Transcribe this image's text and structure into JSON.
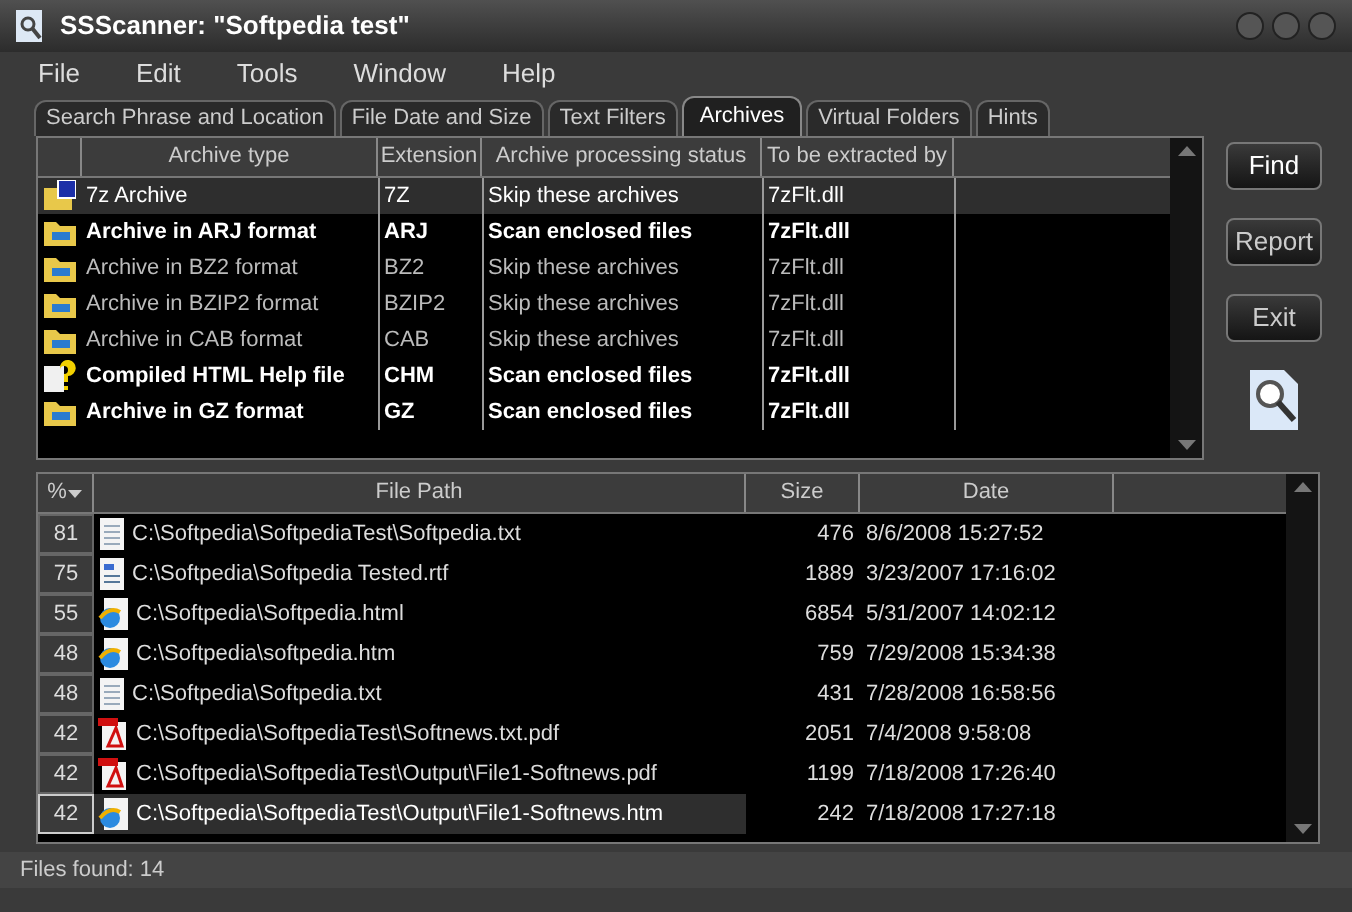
{
  "window": {
    "title": "SSScanner: \"Softpedia test\""
  },
  "menu": [
    "File",
    "Edit",
    "Tools",
    "Window",
    "Help"
  ],
  "tabs": [
    {
      "label": "Search Phrase and Location",
      "selected": false
    },
    {
      "label": "File Date and Size",
      "selected": false
    },
    {
      "label": "Text Filters",
      "selected": false
    },
    {
      "label": "Archives",
      "selected": true
    },
    {
      "label": "Virtual Folders",
      "selected": false
    },
    {
      "label": "Hints",
      "selected": false
    }
  ],
  "archives": {
    "columns": [
      "Archive type",
      "Extension",
      "Archive processing status",
      "To be extracted by"
    ],
    "rows": [
      {
        "kind": "seven-zip",
        "type": "7z Archive",
        "extension": "7Z",
        "status": "Skip these archives",
        "extractor": "7zFlt.dll",
        "scan": false,
        "selected": true
      },
      {
        "kind": "folder",
        "type": "Archive in ARJ format",
        "extension": "ARJ",
        "status": "Scan enclosed files",
        "extractor": "7zFlt.dll",
        "scan": true,
        "selected": false
      },
      {
        "kind": "folder",
        "type": "Archive in BZ2 format",
        "extension": "BZ2",
        "status": "Skip these archives",
        "extractor": "7zFlt.dll",
        "scan": false,
        "selected": false
      },
      {
        "kind": "folder",
        "type": "Archive in BZIP2 format",
        "extension": "BZIP2",
        "status": "Skip these archives",
        "extractor": "7zFlt.dll",
        "scan": false,
        "selected": false
      },
      {
        "kind": "folder",
        "type": "Archive in CAB format",
        "extension": "CAB",
        "status": "Skip these archives",
        "extractor": "7zFlt.dll",
        "scan": false,
        "selected": false
      },
      {
        "kind": "help",
        "type": "Compiled HTML Help file",
        "extension": "CHM",
        "status": "Scan enclosed files",
        "extractor": "7zFlt.dll",
        "scan": true,
        "selected": false
      },
      {
        "kind": "folder",
        "type": "Archive in GZ format",
        "extension": "GZ",
        "status": "Scan enclosed files",
        "extractor": "7zFlt.dll",
        "scan": true,
        "selected": false
      }
    ]
  },
  "buttons": [
    "Find",
    "Report",
    "Exit"
  ],
  "results": {
    "columns": [
      "%",
      "File Path",
      "Size",
      "Date"
    ],
    "rows": [
      {
        "kind": "text",
        "percent": "81",
        "path": "C:\\Softpedia\\SoftpediaTest\\Softpedia.txt",
        "size": "476",
        "date": "8/6/2008 15:27:52",
        "selected": false
      },
      {
        "kind": "rtf",
        "percent": "75",
        "path": "C:\\Softpedia\\Softpedia Tested.rtf",
        "size": "1889",
        "date": "3/23/2007 17:16:02",
        "selected": false
      },
      {
        "kind": "web",
        "percent": "55",
        "path": "C:\\Softpedia\\Softpedia.html",
        "size": "6854",
        "date": "5/31/2007 14:02:12",
        "selected": false
      },
      {
        "kind": "web",
        "percent": "48",
        "path": "C:\\Softpedia\\softpedia.htm",
        "size": "759",
        "date": "7/29/2008 15:34:38",
        "selected": false
      },
      {
        "kind": "text",
        "percent": "48",
        "path": "C:\\Softpedia\\Softpedia.txt",
        "size": "431",
        "date": "7/28/2008 16:58:56",
        "selected": false
      },
      {
        "kind": "pdf",
        "percent": "42",
        "path": "C:\\Softpedia\\SoftpediaTest\\Softnews.txt.pdf",
        "size": "2051",
        "date": "7/4/2008 9:58:08",
        "selected": false
      },
      {
        "kind": "pdf",
        "percent": "42",
        "path": "C:\\Softpedia\\SoftpediaTest\\Output\\File1-Softnews.pdf",
        "size": "1199",
        "date": "7/18/2008 17:26:40",
        "selected": false
      },
      {
        "kind": "web",
        "percent": "42",
        "path": "C:\\Softpedia\\SoftpediaTest\\Output\\File1-Softnews.htm",
        "size": "242",
        "date": "7/18/2008 17:27:18",
        "selected": true
      }
    ]
  },
  "status_bar": "Files found: 14"
}
